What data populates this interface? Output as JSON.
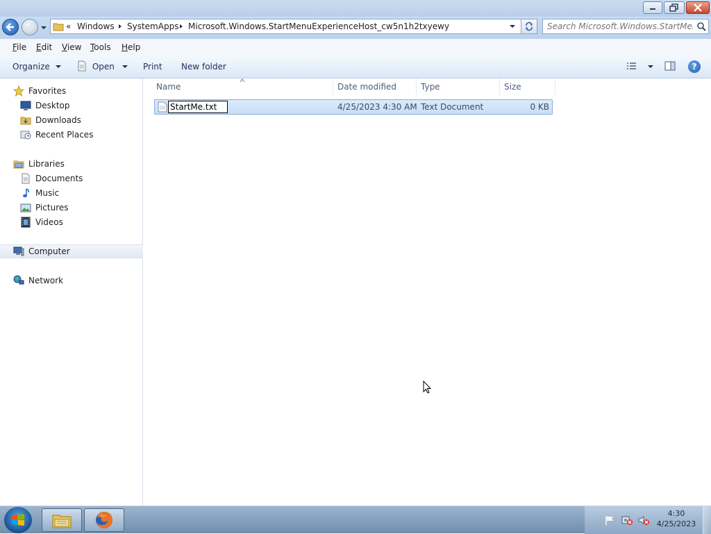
{
  "address": {
    "overflow": "«",
    "crumbs": [
      "Windows",
      "SystemApps",
      "Microsoft.Windows.StartMenuExperienceHost_cw5n1h2txyewy"
    ]
  },
  "search": {
    "placeholder": "Search Microsoft.Windows.StartMenuE..."
  },
  "menu": {
    "file": {
      "key": "F",
      "rest": "ile"
    },
    "edit": {
      "key": "E",
      "rest": "dit"
    },
    "view": {
      "key": "V",
      "rest": "iew"
    },
    "tools": {
      "key": "T",
      "rest": "ools"
    },
    "help": {
      "key": "H",
      "rest": "elp"
    }
  },
  "toolbar": {
    "organize": "Organize",
    "open": "Open",
    "print": "Print",
    "new_folder": "New folder"
  },
  "sidebar": {
    "favorites": "Favorites",
    "desktop": "Desktop",
    "downloads": "Downloads",
    "recent_places": "Recent Places",
    "libraries": "Libraries",
    "documents": "Documents",
    "music": "Music",
    "pictures": "Pictures",
    "videos": "Videos",
    "computer": "Computer",
    "network": "Network"
  },
  "columns": {
    "name": "Name",
    "date_modified": "Date modified",
    "type": "Type",
    "size": "Size"
  },
  "files": [
    {
      "name_edit": "StartMe.txt",
      "date_modified": "4/25/2023 4:30 AM",
      "type": "Text Document",
      "size": "0 KB"
    }
  ],
  "clock": {
    "time": "4:30",
    "date": "4/25/2023"
  },
  "colors": {
    "selection": "#cce0f8",
    "titlebar": "#bcd2ec",
    "close": "#c9452a"
  }
}
